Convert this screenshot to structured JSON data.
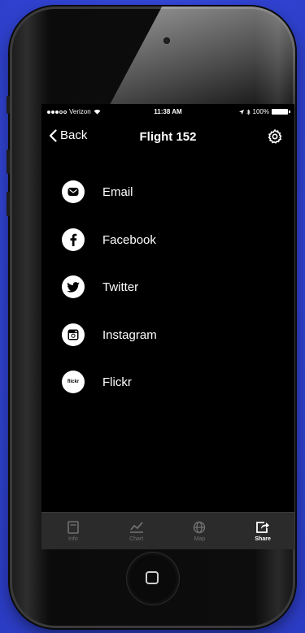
{
  "status_bar": {
    "carrier": "Verizon",
    "time": "11:38 AM",
    "battery": "100%"
  },
  "nav": {
    "back_label": "Back",
    "title": "Flight 152",
    "settings_icon": "gear-icon"
  },
  "share_items": [
    {
      "label": "Email",
      "icon": "envelope-icon"
    },
    {
      "label": "Facebook",
      "icon": "facebook-icon"
    },
    {
      "label": "Twitter",
      "icon": "twitter-icon"
    },
    {
      "label": "Instagram",
      "icon": "instagram-icon"
    },
    {
      "label": "Flickr",
      "icon": "flickr-icon",
      "icon_text": "flickr"
    }
  ],
  "tab_bar": {
    "tabs": [
      {
        "label": "Info",
        "icon": "info-icon",
        "active": false
      },
      {
        "label": "Chart",
        "icon": "chart-icon",
        "active": false
      },
      {
        "label": "Map",
        "icon": "globe-icon",
        "active": false
      },
      {
        "label": "Share",
        "icon": "share-icon",
        "active": true
      }
    ]
  },
  "colors": {
    "background": "#3346d8",
    "screen": "#000000",
    "tab_bar": "#2b2b2b",
    "active_tab": "#ffffff",
    "inactive_tab": "#6f6f6f"
  }
}
